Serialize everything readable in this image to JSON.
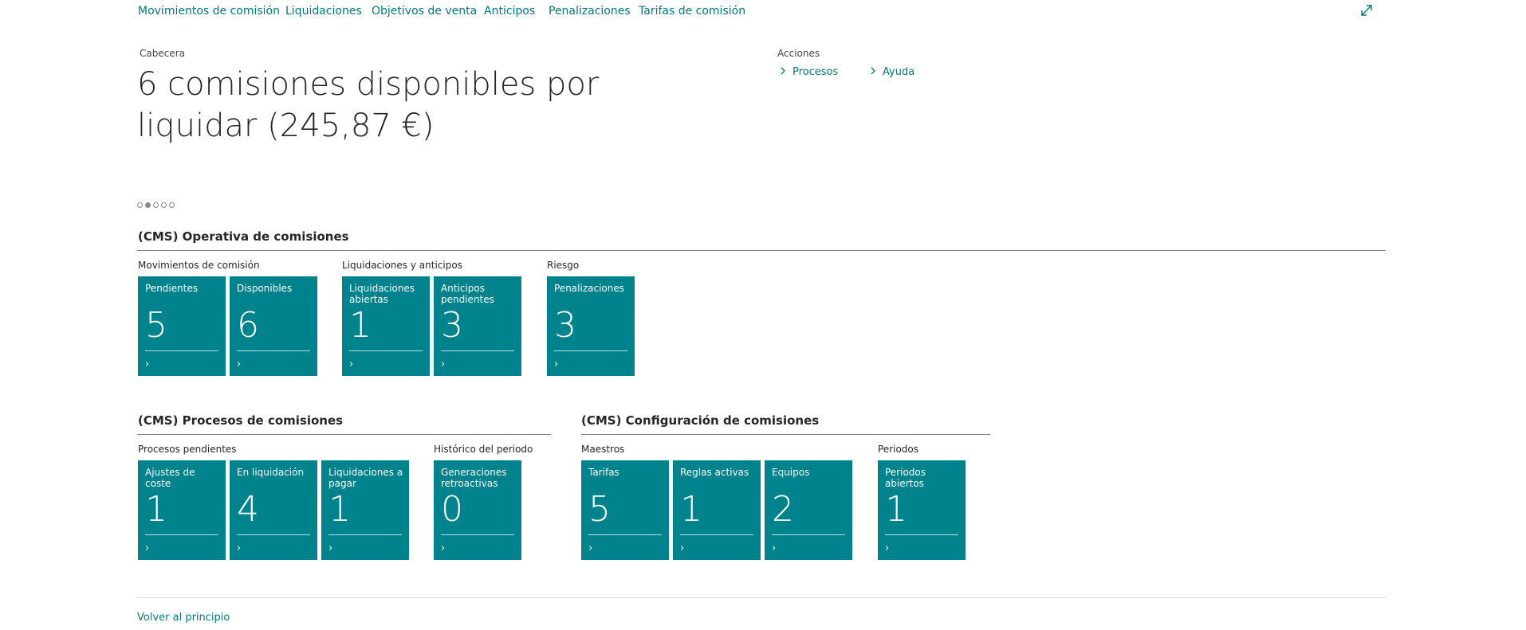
{
  "nav": {
    "links": [
      "Movimientos de comisión",
      "Liquidaciones",
      "Objetivos de venta",
      "Anticipos",
      "Penalizaciones",
      "Tarifas de comisión"
    ]
  },
  "header": {
    "caption": "Cabecera",
    "headline_line1": "6 comisiones disponibles por",
    "headline_line2": "liquidar (245,87 €)"
  },
  "actions": {
    "caption": "Acciones",
    "items": [
      "Procesos",
      "Ayuda"
    ]
  },
  "icons": {
    "expand": "expand-icon",
    "chevron": "chevron-right-icon"
  },
  "carousel": {
    "total": 5,
    "active_index": 1
  },
  "sections": {
    "operativa": {
      "title": "(CMS) Operativa de comisiones",
      "groups": [
        {
          "title": "Movimientos de comisión",
          "tiles": [
            {
              "label": "Pendientes",
              "value": "5"
            },
            {
              "label": "Disponibles",
              "value": "6"
            }
          ]
        },
        {
          "title": "Liquidaciones y anticipos",
          "tiles": [
            {
              "label": "Liquidaciones abiertas",
              "value": "1"
            },
            {
              "label": "Anticipos pendientes",
              "value": "3"
            }
          ]
        },
        {
          "title": "Riesgo",
          "tiles": [
            {
              "label": "Penalizaciones",
              "value": "3"
            }
          ]
        }
      ]
    },
    "procesos": {
      "title": "(CMS) Procesos de comisiones",
      "groups": [
        {
          "title": "Procesos pendientes",
          "tiles": [
            {
              "label": "Ajustes de coste",
              "value": "1"
            },
            {
              "label": "En liquidación",
              "value": "4"
            },
            {
              "label": "Liquidaciones a pagar",
              "value": "1"
            }
          ]
        },
        {
          "title": "Histórico del periodo",
          "tiles": [
            {
              "label": "Generaciones retroactivas",
              "value": "0"
            }
          ]
        }
      ]
    },
    "configuracion": {
      "title": "(CMS) Configuración de comisiones",
      "groups": [
        {
          "title": "Maestros",
          "tiles": [
            {
              "label": "Tarifas",
              "value": "5"
            },
            {
              "label": "Reglas activas",
              "value": "1"
            },
            {
              "label": "Equipos",
              "value": "2"
            }
          ]
        },
        {
          "title": "Periodos",
          "tiles": [
            {
              "label": "Periodos abiertos",
              "value": "1"
            }
          ]
        }
      ]
    }
  },
  "colors": {
    "accent": "#00797f",
    "tile": "#00838c"
  },
  "footer": {
    "back_to_top": "Volver al principio"
  }
}
